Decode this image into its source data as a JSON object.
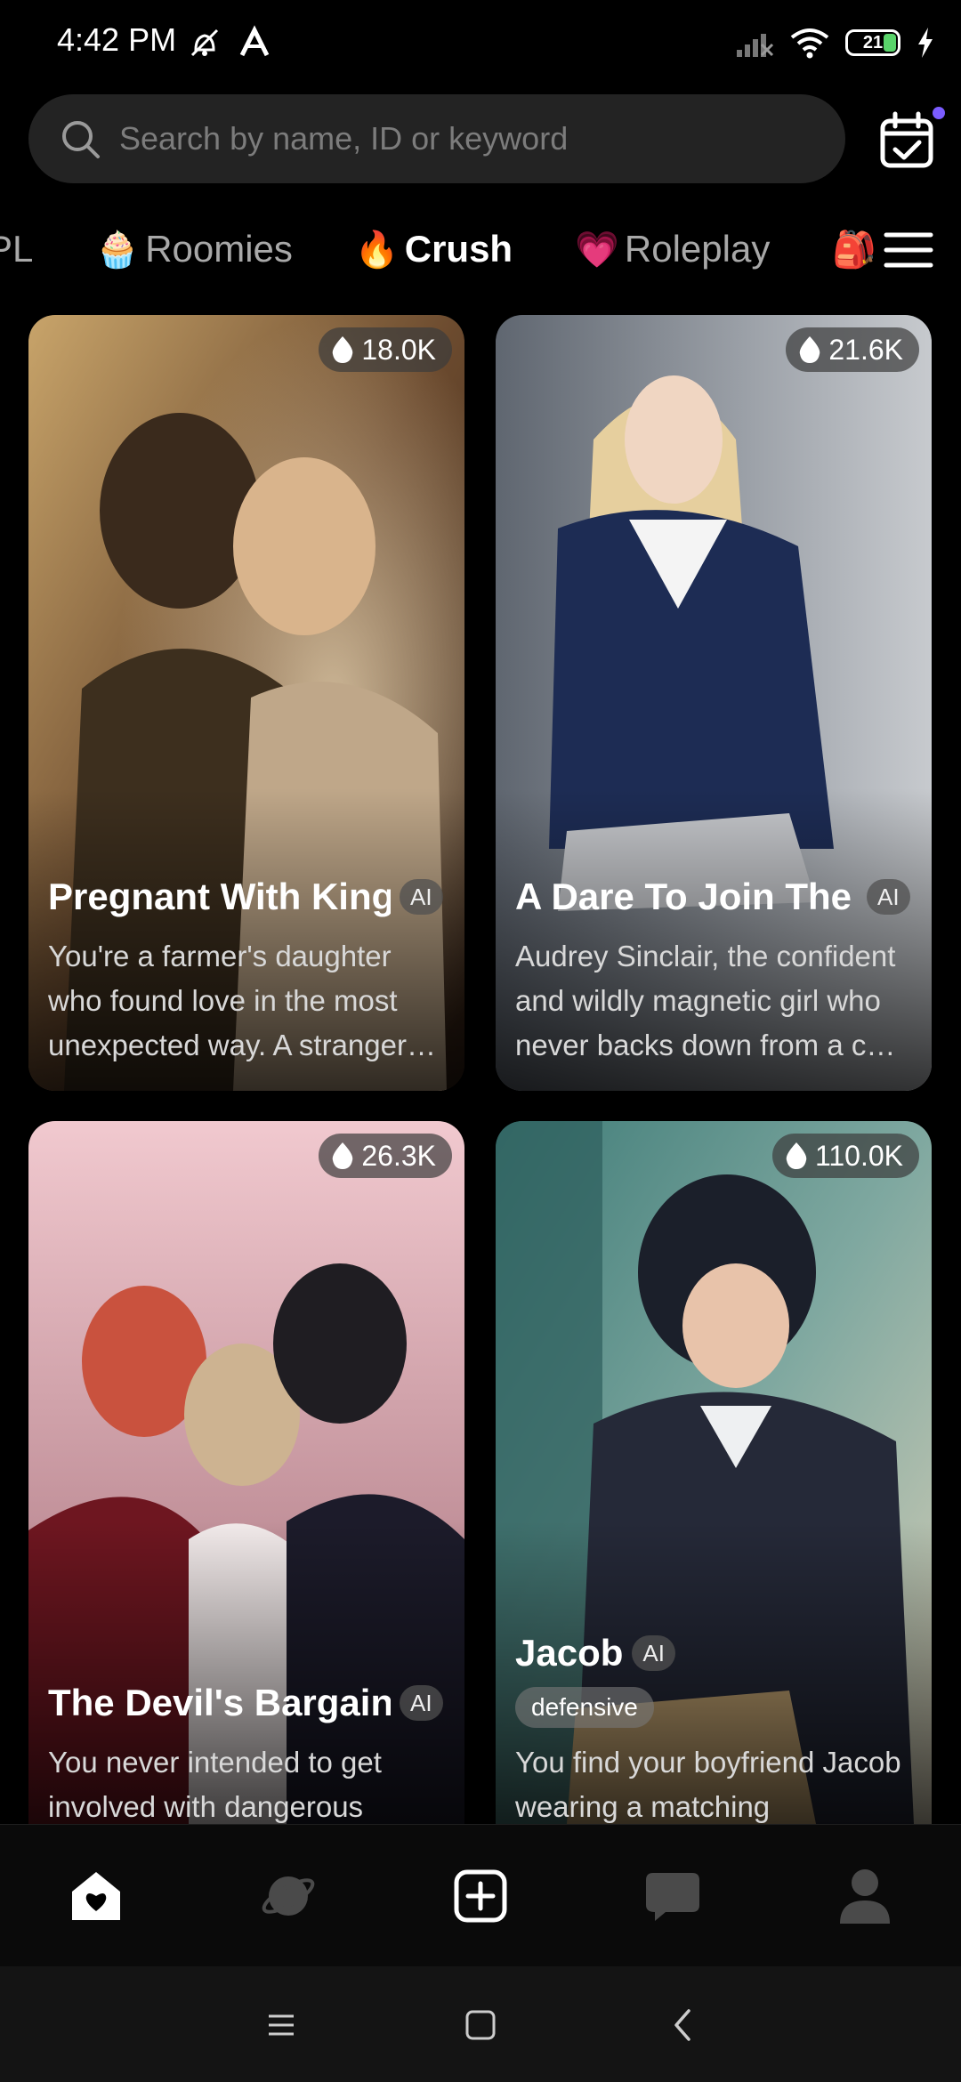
{
  "status_bar": {
    "time": "4:42 PM",
    "battery": "21",
    "icons": [
      "mute-alarm-icon",
      "a-icon",
      "signal-icon",
      "wifi-icon",
      "battery-icon",
      "charging-icon"
    ]
  },
  "search": {
    "placeholder": "Search by name, ID or keyword",
    "value": ""
  },
  "categories": [
    {
      "label": "PL",
      "emoji": ""
    },
    {
      "label": "Roomies",
      "emoji": "🧁"
    },
    {
      "label": "Crush",
      "emoji": "🔥"
    },
    {
      "label": "Roleplay",
      "emoji": "💗"
    },
    {
      "label": "",
      "emoji": "🎒"
    }
  ],
  "active_category": "Crush",
  "cards": [
    {
      "title": "Pregnant With King's Child",
      "ai": "AI",
      "count": "18.0K",
      "description": "You're a farmer's daughter who found love in the most unexpected way. A stranger…"
    },
    {
      "title": "A Dare To Join The Club",
      "ai": "AI",
      "count": "21.6K",
      "description": "Audrey Sinclair, the confident and wildly magnetic girl who never backs down from a c…"
    },
    {
      "title": "The Devil's Bargain",
      "ai": "AI",
      "count": "26.3K",
      "description": "You never intended to get involved with dangerous"
    },
    {
      "title": "Jacob",
      "ai": "AI",
      "tag": "defensive",
      "count": "110.0K",
      "description": "You find your boyfriend Jacob wearing a matching"
    }
  ],
  "bottom_nav": [
    "home-icon",
    "explore-planet-icon",
    "create-plus-icon",
    "chat-icon",
    "profile-icon"
  ],
  "colors": {
    "background": "#000000",
    "search_bg": "#232323",
    "accent_dot": "#7b5cff",
    "battery_green": "#59d36a"
  }
}
